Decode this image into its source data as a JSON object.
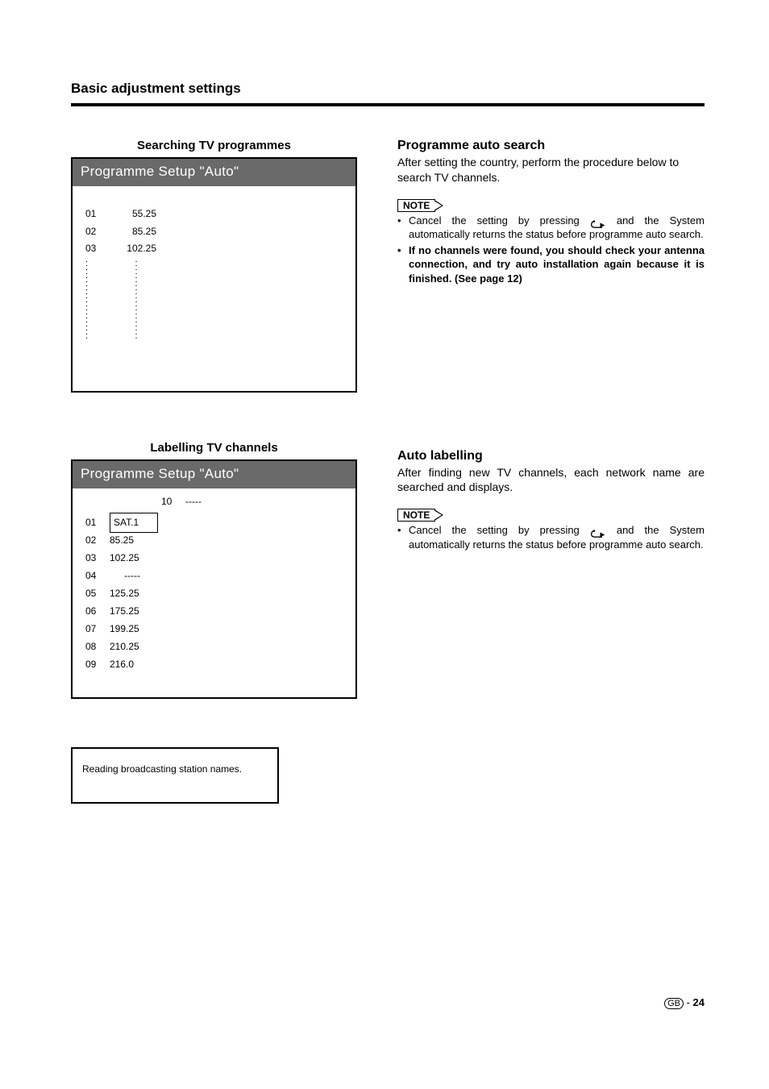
{
  "title": "Basic adjustment settings",
  "left": {
    "section1": {
      "label": "Searching TV programmes",
      "osd_title": "Programme Setup \"Auto\"",
      "rows": [
        {
          "num": "01",
          "val": "55.25"
        },
        {
          "num": "02",
          "val": "85.25"
        },
        {
          "num": "03",
          "val": "102.25"
        }
      ]
    },
    "section2": {
      "label": "Labelling TV channels",
      "osd_title": "Programme Setup \"Auto\"",
      "header_col_a": "10",
      "header_col_b": "-----",
      "rows": [
        {
          "num": "01",
          "val": "SAT.1",
          "selected": true
        },
        {
          "num": "02",
          "val": "85.25"
        },
        {
          "num": "03",
          "val": "102.25"
        },
        {
          "num": "04",
          "val": "-----"
        },
        {
          "num": "05",
          "val": "125.25"
        },
        {
          "num": "06",
          "val": "175.25"
        },
        {
          "num": "07",
          "val": "199.25"
        },
        {
          "num": "08",
          "val": "210.25"
        },
        {
          "num": "09",
          "val": "216.0"
        }
      ],
      "caption": "Reading broadcasting station names."
    }
  },
  "right": {
    "block1": {
      "heading": "Programme auto search",
      "intro": "After setting the country, perform the procedure below to search TV channels.",
      "note_label": "NOTE",
      "note1_a": "Cancel the setting by pressing ",
      "note1_b": " and the System automatically returns the status before programme auto search.",
      "note2": "If no channels were found, you should check your antenna connection, and try auto installation again because it is finished. (See page 12)"
    },
    "block2": {
      "heading": "Auto labelling",
      "intro": "After finding new TV channels, each network name are searched and displays.",
      "note_label": "NOTE",
      "note1_a": "Cancel the setting by pressing ",
      "note1_b": " and the System automatically returns the status before programme auto search."
    }
  },
  "footer": {
    "region": "GB",
    "sep": " - ",
    "page": "24"
  }
}
